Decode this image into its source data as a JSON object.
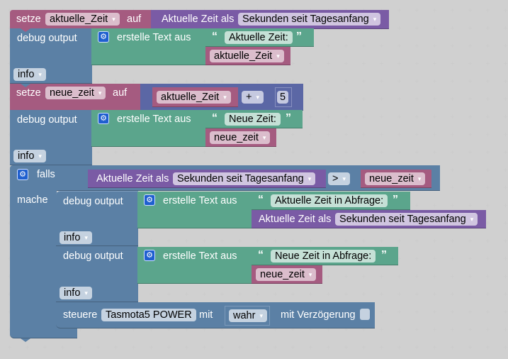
{
  "workspace": {
    "grid_color": "#cccccc",
    "colors": {
      "variable": "#a55b80",
      "statement": "#5b80a5",
      "text": "#5ba58c",
      "time": "#7a5ba5",
      "math": "#5b67a5"
    }
  },
  "blocks": {
    "set1": {
      "label_set": "setze",
      "variable": "aktuelle_Zeit",
      "label_to": "auf",
      "value": {
        "label": "Aktuelle Zeit als",
        "format": "Sekunden seit Tagesanfang"
      }
    },
    "debug1": {
      "label": "debug output",
      "create_text_label": "erstelle Text aus",
      "text_value": "Aktuelle Zeit:",
      "variable": "aktuelle_Zeit",
      "level": "info"
    },
    "set2": {
      "label_set": "setze",
      "variable": "neue_zeit",
      "label_to": "auf",
      "math": {
        "variable": "aktuelle_Zeit",
        "operator": "+",
        "number": "5"
      }
    },
    "debug2": {
      "label": "debug output",
      "create_text_label": "erstelle Text aus",
      "text_value": "Neue Zeit:",
      "variable": "neue_zeit",
      "level": "info"
    },
    "if": {
      "label_if": "falls",
      "label_do": "mache",
      "condition": {
        "label": "Aktuelle Zeit als",
        "format": "Sekunden seit Tagesanfang",
        "operator": ">",
        "variable": "neue_zeit"
      },
      "debug3": {
        "label": "debug output",
        "create_text_label": "erstelle Text aus",
        "text_value": "Aktuelle Zeit in Abfrage:",
        "time_label": "Aktuelle Zeit als",
        "time_format": "Sekunden seit Tagesanfang",
        "level": "info"
      },
      "debug4": {
        "label": "debug output",
        "create_text_label": "erstelle Text aus",
        "text_value": "Neue Zeit in Abfrage:",
        "variable": "neue_zeit",
        "level": "info"
      },
      "control": {
        "label": "steuere",
        "device": "Tasmota5 POWER",
        "label_with": "mit",
        "value": "wahr",
        "label_delay": "mit Verzögerung",
        "delay_checked": false
      }
    }
  },
  "icons": {
    "dropdown": "▾",
    "gear": "⚙",
    "quote_open": "“",
    "quote_close": "”"
  }
}
